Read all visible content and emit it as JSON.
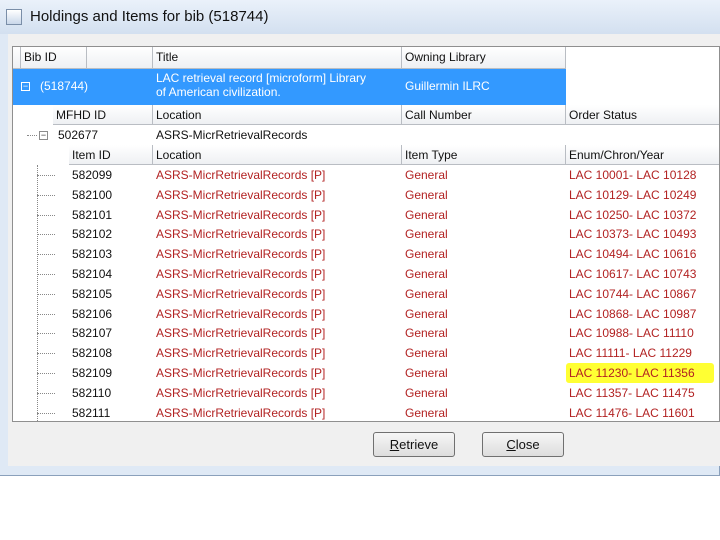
{
  "window": {
    "title": "Holdings and Items for bib (518744)"
  },
  "bib_header": {
    "bib_id": "Bib ID",
    "title": "Title",
    "owning_library": "Owning Library"
  },
  "bib": {
    "id": "(518744)",
    "title_line1": "LAC retrieval record [microform] Library",
    "title_line2": "of American civilization.",
    "owning_library": "Guillermin ILRC"
  },
  "mfhd_header": {
    "mfhd_id": "MFHD ID",
    "location": "Location",
    "call_number": "Call Number",
    "order_status": "Order Status"
  },
  "mfhd": {
    "id": "502677",
    "location": "ASRS-MicrRetrievalRecords"
  },
  "item_header": {
    "item_id": "Item ID",
    "location": "Location",
    "item_type": "Item Type",
    "enum": "Enum/Chron/Year"
  },
  "items": [
    {
      "id": "582099",
      "location": "ASRS-MicrRetrievalRecords [P]",
      "type": "General",
      "enum": "LAC 10001- LAC 10128"
    },
    {
      "id": "582100",
      "location": "ASRS-MicrRetrievalRecords [P]",
      "type": "General",
      "enum": "LAC 10129- LAC 10249"
    },
    {
      "id": "582101",
      "location": "ASRS-MicrRetrievalRecords [P]",
      "type": "General",
      "enum": "LAC 10250- LAC 10372"
    },
    {
      "id": "582102",
      "location": "ASRS-MicrRetrievalRecords [P]",
      "type": "General",
      "enum": "LAC 10373- LAC 10493"
    },
    {
      "id": "582103",
      "location": "ASRS-MicrRetrievalRecords [P]",
      "type": "General",
      "enum": "LAC 10494- LAC 10616"
    },
    {
      "id": "582104",
      "location": "ASRS-MicrRetrievalRecords [P]",
      "type": "General",
      "enum": "LAC 10617- LAC 10743"
    },
    {
      "id": "582105",
      "location": "ASRS-MicrRetrievalRecords [P]",
      "type": "General",
      "enum": "LAC 10744- LAC 10867"
    },
    {
      "id": "582106",
      "location": "ASRS-MicrRetrievalRecords [P]",
      "type": "General",
      "enum": "LAC 10868- LAC 10987"
    },
    {
      "id": "582107",
      "location": "ASRS-MicrRetrievalRecords [P]",
      "type": "General",
      "enum": "LAC 10988- LAC 11110"
    },
    {
      "id": "582108",
      "location": "ASRS-MicrRetrievalRecords [P]",
      "type": "General",
      "enum": "LAC 11111- LAC 11229"
    },
    {
      "id": "582109",
      "location": "ASRS-MicrRetrievalRecords [P]",
      "type": "General",
      "enum": "LAC 11230- LAC 11356",
      "highlighted": true
    },
    {
      "id": "582110",
      "location": "ASRS-MicrRetrievalRecords [P]",
      "type": "General",
      "enum": "LAC 11357- LAC 11475"
    },
    {
      "id": "582111",
      "location": "ASRS-MicrRetrievalRecords [P]",
      "type": "General",
      "enum": "LAC 11476- LAC 11601"
    }
  ],
  "buttons": {
    "retrieve": {
      "accel": "R",
      "rest": "etrieve"
    },
    "close": {
      "accel": "C",
      "rest": "lose"
    }
  },
  "icons": {
    "expand_collapse": "minus-box-icon",
    "app": "window-icon"
  },
  "colors": {
    "selection": "#3399ff",
    "item_text": "#b22222",
    "highlight": "#ffff33"
  }
}
